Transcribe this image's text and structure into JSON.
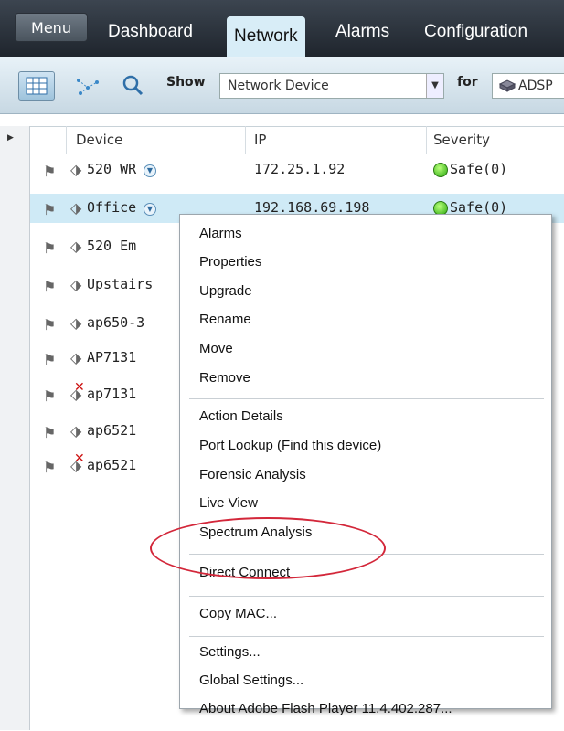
{
  "nav": {
    "menu_label": "Menu",
    "tabs": [
      {
        "label": "Dashboard"
      },
      {
        "label": "Network"
      },
      {
        "label": "Alarms"
      },
      {
        "label": "Configuration"
      }
    ]
  },
  "toolbar": {
    "show_label": "Show",
    "show_value": "Network Device",
    "for_label": "for",
    "for_value": "ADSP"
  },
  "grid": {
    "columns": [
      "Device",
      "IP",
      "Severity"
    ],
    "rows": [
      {
        "name": "520 WR",
        "ip": "172.25.1.92",
        "severity": "Safe(0)"
      },
      {
        "name": "Office",
        "ip": "192.168.69.198",
        "severity": "Safe(0)"
      },
      {
        "name": "520 Em"
      },
      {
        "name": "Upstairs"
      },
      {
        "name": "ap650-3"
      },
      {
        "name": "AP7131"
      },
      {
        "name": "ap7131"
      },
      {
        "name": "ap6521"
      },
      {
        "name": "ap6521"
      }
    ]
  },
  "context_menu": {
    "items": [
      "Alarms",
      "Properties",
      "Upgrade",
      "Rename",
      "Move",
      "Remove",
      "Action Details",
      "Port Lookup (Find this device)",
      "Forensic Analysis",
      "Live View",
      "Spectrum Analysis",
      "Direct Connect",
      "Copy MAC...",
      "Settings...",
      "Global Settings...",
      "About Adobe Flash Player 11.4.402.287..."
    ]
  },
  "colors": {
    "highlight_circle": "#d3273a",
    "selected_row": "#cfeaf6",
    "active_tab": "#d8edf7"
  }
}
